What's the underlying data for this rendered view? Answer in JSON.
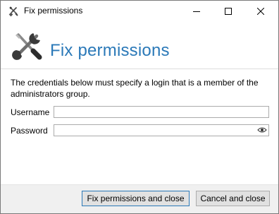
{
  "window": {
    "title": "Fix permissions",
    "app_icon": "tools-icon",
    "controls": [
      "minimize-icon",
      "maximize-icon",
      "close-icon"
    ]
  },
  "header": {
    "title": "Fix permissions",
    "icon": "tools-icon",
    "title_color": "#2b79b8"
  },
  "form": {
    "description": "The credentials below must specify a login that is a member of the administrators group.",
    "username_label": "Username",
    "username_value": "",
    "password_label": "Password",
    "password_value": "",
    "password_reveal_icon": "eye-icon"
  },
  "footer": {
    "fix_button": "Fix permissions and close",
    "cancel_button": "Cancel and close"
  }
}
